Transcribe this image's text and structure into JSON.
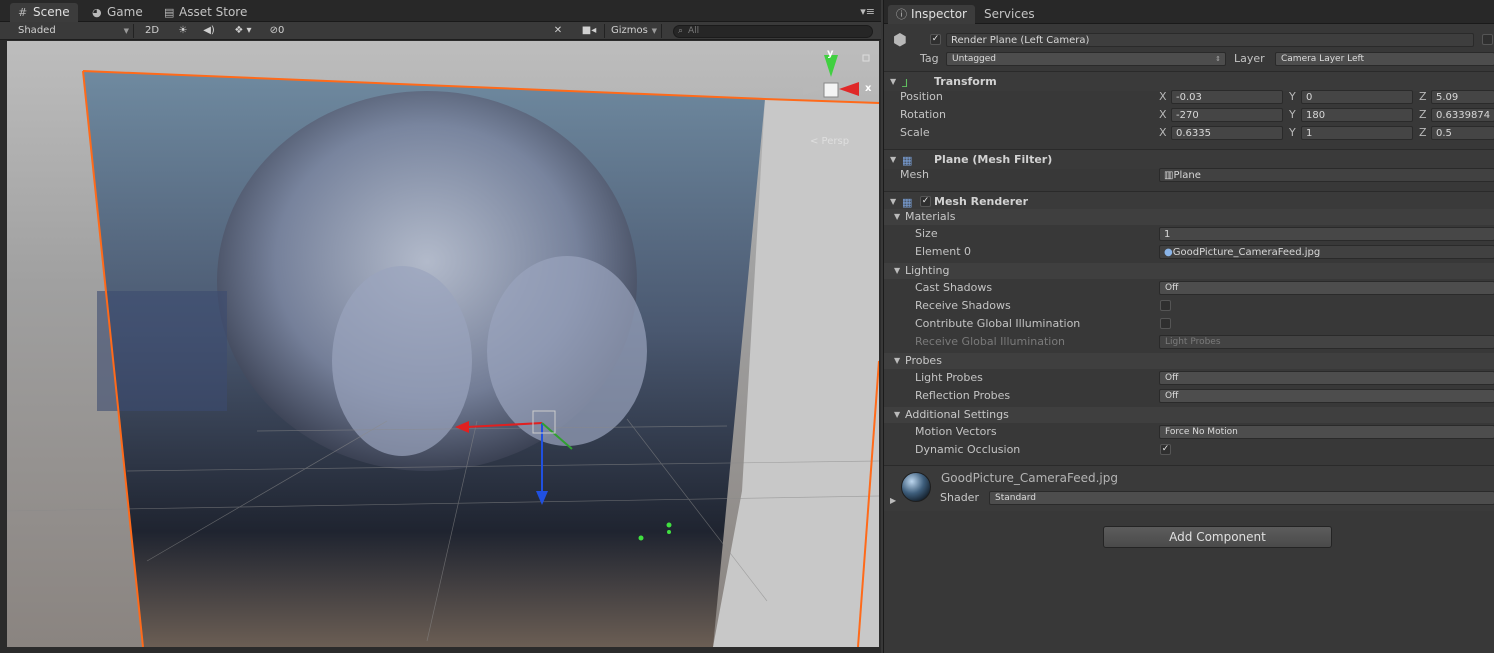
{
  "scene_tabs": {
    "scene": "Scene",
    "game": "Game",
    "asset_store": "Asset Store"
  },
  "scene_toolbar": {
    "shading_mode": "Shaded",
    "mode_2d": "2D",
    "hidden_count": "0",
    "gizmos": "Gizmos",
    "search_placeholder": "All"
  },
  "viewport": {
    "persp_label": "< Persp",
    "axis_y": "y",
    "axis_x": "x"
  },
  "inspector_tabs": {
    "inspector": "Inspector",
    "services": "Services"
  },
  "object": {
    "name": "Render Plane (Left Camera)",
    "tag_label": "Tag",
    "tag_value": "Untagged",
    "layer_label": "Layer",
    "layer_value": "Camera Layer Left"
  },
  "transform": {
    "title": "Transform",
    "position_label": "Position",
    "rotation_label": "Rotation",
    "scale_label": "Scale",
    "axis_x": "X",
    "axis_y": "Y",
    "axis_z": "Z",
    "position": {
      "x": "-0.03",
      "y": "0",
      "z": "5.09"
    },
    "rotation": {
      "x": "-270",
      "y": "180",
      "z": "0.6339874"
    },
    "scale": {
      "x": "0.6335",
      "y": "1",
      "z": "0.5"
    }
  },
  "mesh_filter": {
    "title": "Plane (Mesh Filter)",
    "mesh_label": "Mesh",
    "mesh_value": "Plane"
  },
  "mesh_renderer": {
    "title": "Mesh Renderer",
    "materials_label": "Materials",
    "size_label": "Size",
    "size_value": "1",
    "element0_label": "Element 0",
    "element0_value": "GoodPicture_CameraFeed.jpg",
    "lighting_label": "Lighting",
    "cast_shadows_label": "Cast Shadows",
    "cast_shadows_value": "Off",
    "receive_shadows_label": "Receive Shadows",
    "contribute_gi_label": "Contribute Global Illumination",
    "receive_gi_label": "Receive Global Illumination",
    "receive_gi_value": "Light Probes",
    "probes_label": "Probes",
    "light_probes_label": "Light Probes",
    "light_probes_value": "Off",
    "reflection_probes_label": "Reflection Probes",
    "reflection_probes_value": "Off",
    "additional_label": "Additional Settings",
    "motion_vectors_label": "Motion Vectors",
    "motion_vectors_value": "Force No Motion",
    "dynamic_occlusion_label": "Dynamic Occlusion"
  },
  "material": {
    "name": "GoodPicture_CameraFeed.jpg",
    "shader_label": "Shader",
    "shader_value": "Standard"
  },
  "add_component_label": "Add Component",
  "colors": {
    "selection_outline": "#ff6a1a",
    "axis_x": "#e02020",
    "axis_y": "#30c030",
    "axis_z": "#2050e0"
  },
  "icons": {
    "scene_tab": "hash-grid-icon",
    "game_tab": "pacman-icon",
    "asset_store_tab": "shopping-bag-icon",
    "inspector_tab": "info-icon",
    "transform": "transform-axes-icon",
    "mesh_filter": "mesh-grid-icon",
    "mesh_renderer": "mesh-renderer-icon",
    "cube": "cube-icon"
  }
}
